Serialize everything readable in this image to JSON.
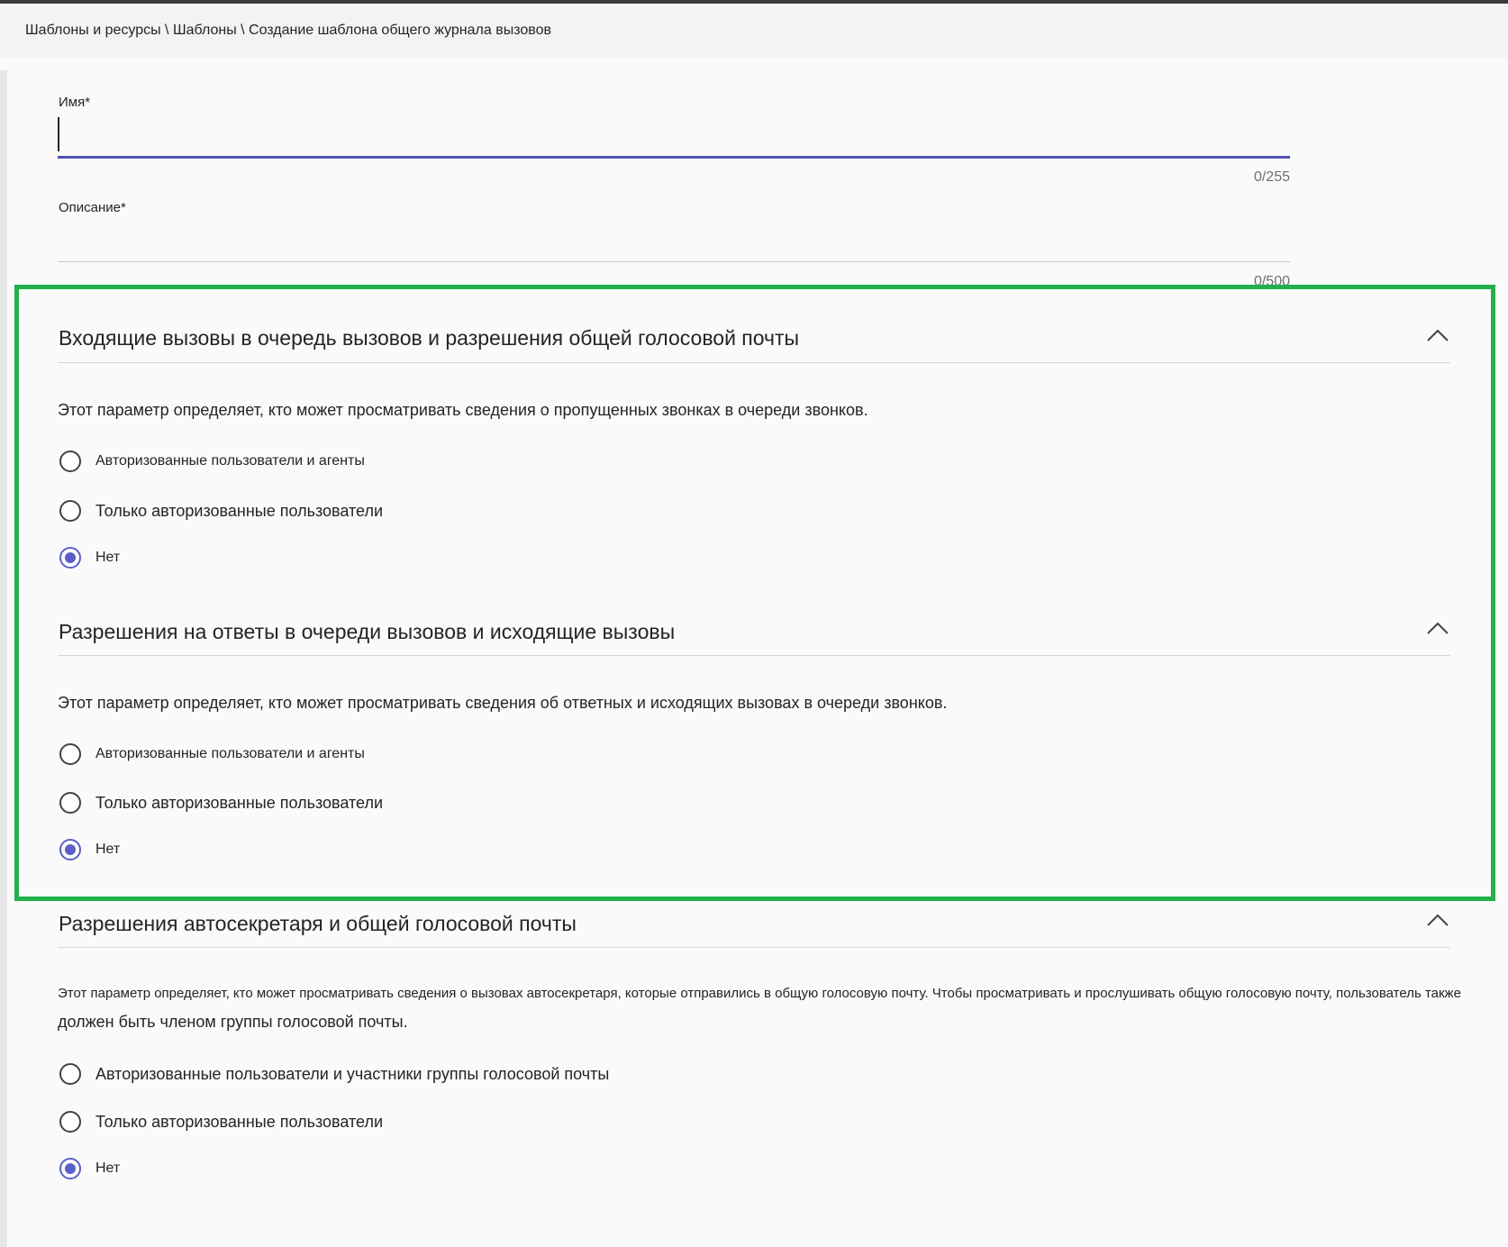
{
  "breadcrumb": "Шаблоны и ресурсы \\ Шаблоны \\ Создание шаблона общего журнала вызовов",
  "colors": {
    "accent": "#5b5fc7",
    "highlight_border": "#22b04b"
  },
  "form": {
    "name": {
      "label": "Имя*",
      "value": "",
      "counter": "0/255"
    },
    "description": {
      "label": "Описание*",
      "value": "",
      "counter": "0/500"
    }
  },
  "sections": [
    {
      "title": "Входящие вызовы в очередь вызовов и разрешения общей голосовой почты",
      "description": "Этот параметр определяет, кто может просматривать сведения о пропущенных звонках в очереди звонков.",
      "options": [
        {
          "label": "Авторизованные пользователи и агенты",
          "selected": false
        },
        {
          "label": "Только авторизованные пользователи",
          "selected": false
        },
        {
          "label": "Нет",
          "selected": true
        }
      ]
    },
    {
      "title": "Разрешения на ответы в очереди вызовов и исходящие вызовы",
      "description": "Этот параметр определяет, кто может просматривать сведения об ответных и исходящих вызовах в очереди звонков.",
      "options": [
        {
          "label": "Авторизованные пользователи и агенты",
          "selected": false
        },
        {
          "label": "Только авторизованные пользователи",
          "selected": false
        },
        {
          "label": "Нет",
          "selected": true
        }
      ]
    },
    {
      "title": "Разрешения автосекретаря и общей голосовой почты",
      "description": "Этот параметр определяет, кто может просматривать сведения о вызовах автосекретаря, которые отправились в общую голосовую почту. Чтобы просматривать и прослушивать общую голосовую почту, пользователь также",
      "description_line2": "должен быть членом группы голосовой почты.",
      "options": [
        {
          "label": "Авторизованные пользователи и участники группы голосовой почты",
          "selected": false
        },
        {
          "label": "Только авторизованные пользователи",
          "selected": false
        },
        {
          "label": "Нет",
          "selected": true
        }
      ]
    }
  ]
}
